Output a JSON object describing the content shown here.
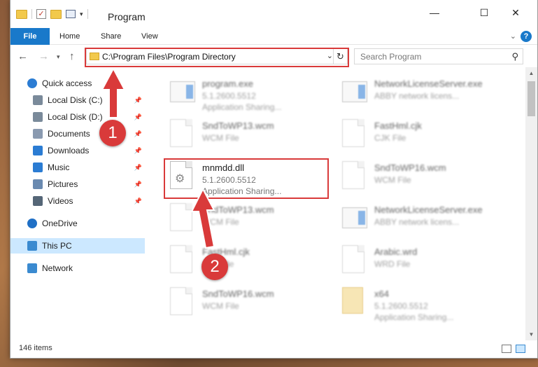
{
  "window": {
    "title": "Program",
    "minimize_glyph": "—",
    "maximize_glyph": "☐",
    "close_glyph": "✕"
  },
  "ribbon": {
    "tabs": [
      "File",
      "Home",
      "Share",
      "View"
    ],
    "help_glyph": "?"
  },
  "address": {
    "path": "C:\\Program Files\\Program Directory"
  },
  "search": {
    "placeholder": "Search Program"
  },
  "sidebar": {
    "items": [
      {
        "label": "Quick access",
        "icon": "star-icon",
        "pinned": false
      },
      {
        "label": "Local Disk (C:)",
        "icon": "drive-icon",
        "pinned": true
      },
      {
        "label": "Local Disk (D:)",
        "icon": "drive-icon",
        "pinned": true
      },
      {
        "label": "Documents",
        "icon": "documents-icon",
        "pinned": true
      },
      {
        "label": "Downloads",
        "icon": "download-icon",
        "pinned": true
      },
      {
        "label": "Music",
        "icon": "music-icon",
        "pinned": true
      },
      {
        "label": "Pictures",
        "icon": "pictures-icon",
        "pinned": true
      },
      {
        "label": "Videos",
        "icon": "videos-icon",
        "pinned": true
      },
      {
        "label": "OneDrive",
        "icon": "cloud-icon",
        "pinned": false
      },
      {
        "label": "This PC",
        "icon": "computer-icon",
        "pinned": false,
        "selected": true
      },
      {
        "label": "Network",
        "icon": "network-icon",
        "pinned": false
      }
    ]
  },
  "files": [
    {
      "name": "program.exe",
      "meta1": "5.1.2600.5512",
      "meta2": "Application Sharing...",
      "type": "exe",
      "blurred": true
    },
    {
      "name": "NetworkLicenseServer.exe",
      "meta1": "ABBY network licens...",
      "meta2": "",
      "type": "exe",
      "blurred": true
    },
    {
      "name": "SndToWP13.wcm",
      "meta1": "WCM File",
      "meta2": "",
      "type": "doc",
      "blurred": true
    },
    {
      "name": "FastHml.cjk",
      "meta1": "CJK File",
      "meta2": "",
      "type": "doc",
      "blurred": true
    },
    {
      "name": "mnmdd.dll",
      "meta1": "5.1.2600.5512",
      "meta2": "Application Sharing...",
      "type": "dll",
      "blurred": false
    },
    {
      "name": "SndToWP16.wcm",
      "meta1": "WCM File",
      "meta2": "",
      "type": "doc",
      "blurred": true
    },
    {
      "name": "SndToWP13.wcm",
      "meta1": "WCM File",
      "meta2": "",
      "type": "doc",
      "blurred": true
    },
    {
      "name": "NetworkLicenseServer.exe",
      "meta1": "ABBY network licens...",
      "meta2": "",
      "type": "exe",
      "blurred": true
    },
    {
      "name": "FastHml.cjk",
      "meta1": "CJK File",
      "meta2": "",
      "type": "doc",
      "blurred": true
    },
    {
      "name": "Arabic.wrd",
      "meta1": "WRD File",
      "meta2": "",
      "type": "doc",
      "blurred": true
    },
    {
      "name": "SndToWP16.wcm",
      "meta1": "WCM File",
      "meta2": "",
      "type": "doc",
      "blurred": true
    },
    {
      "name": "x64",
      "meta1": "5.1.2600.5512",
      "meta2": "Application Sharing...",
      "type": "folder",
      "blurred": true
    }
  ],
  "status": {
    "item_count": "146 items"
  },
  "annotations": {
    "step1": "1",
    "step2": "2",
    "color": "#d93a3a"
  }
}
